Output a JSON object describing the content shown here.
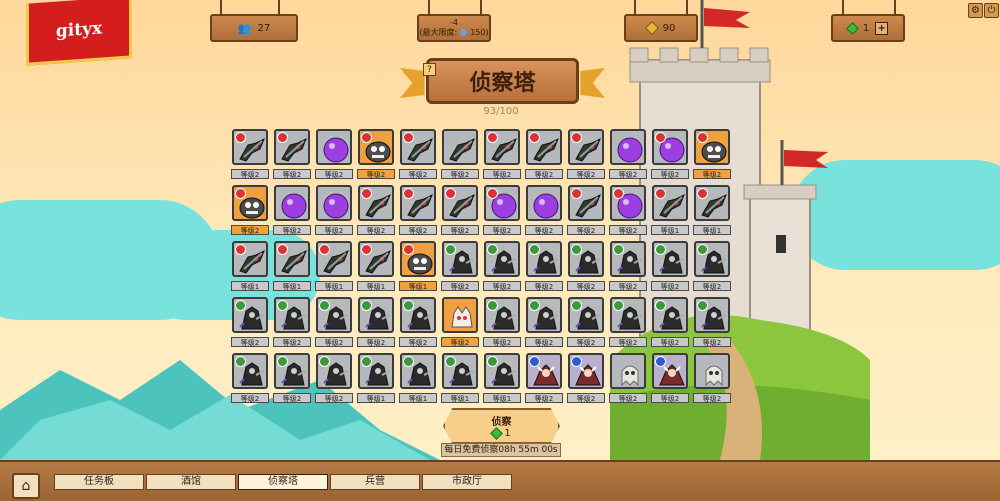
{
  "header": {
    "logo_text": "gityx",
    "population": "27",
    "limit_top": "-4",
    "limit_label": "(最大限度:",
    "limit_value": "150)",
    "gold": "90",
    "gems": "1",
    "plus_label": "+"
  },
  "title": {
    "text": "侦察塔",
    "help": "?",
    "progress": "93/100"
  },
  "cards": [
    {
      "c": "gray",
      "b": "red",
      "f": "sword",
      "l": "等级2",
      "o": false
    },
    {
      "c": "gray",
      "b": "red",
      "f": "sword",
      "l": "等级2",
      "o": false
    },
    {
      "c": "gray",
      "b": "none",
      "f": "blob",
      "l": "等级2",
      "o": false
    },
    {
      "c": "orange",
      "b": "red",
      "f": "ogre",
      "l": "等级2",
      "o": true
    },
    {
      "c": "gray",
      "b": "red",
      "f": "sword",
      "l": "等级2",
      "o": false
    },
    {
      "c": "gray",
      "b": "none",
      "f": "sword",
      "l": "等级2",
      "o": false
    },
    {
      "c": "gray",
      "b": "red",
      "f": "sword",
      "l": "等级2",
      "o": false
    },
    {
      "c": "gray",
      "b": "red",
      "f": "sword",
      "l": "等级2",
      "o": false
    },
    {
      "c": "gray",
      "b": "red",
      "f": "sword",
      "l": "等级2",
      "o": false
    },
    {
      "c": "gray",
      "b": "none",
      "f": "blob",
      "l": "等级2",
      "o": false
    },
    {
      "c": "gray",
      "b": "red",
      "f": "blob",
      "l": "等级2",
      "o": false
    },
    {
      "c": "orange",
      "b": "red",
      "f": "ogre",
      "l": "等级2",
      "o": true
    },
    {
      "c": "orange",
      "b": "red",
      "f": "ogre",
      "l": "等级2",
      "o": true
    },
    {
      "c": "gray",
      "b": "none",
      "f": "blob",
      "l": "等级2",
      "o": false
    },
    {
      "c": "gray",
      "b": "none",
      "f": "blob",
      "l": "等级2",
      "o": false
    },
    {
      "c": "gray",
      "b": "red",
      "f": "sword",
      "l": "等级2",
      "o": false
    },
    {
      "c": "gray",
      "b": "red",
      "f": "sword",
      "l": "等级2",
      "o": false
    },
    {
      "c": "gray",
      "b": "red",
      "f": "sword",
      "l": "等级2",
      "o": false
    },
    {
      "c": "gray",
      "b": "red",
      "f": "blob",
      "l": "等级2",
      "o": false
    },
    {
      "c": "gray",
      "b": "none",
      "f": "blob",
      "l": "等级2",
      "o": false
    },
    {
      "c": "gray",
      "b": "red",
      "f": "sword",
      "l": "等级2",
      "o": false
    },
    {
      "c": "gray",
      "b": "red",
      "f": "blob",
      "l": "等级2",
      "o": false
    },
    {
      "c": "gray",
      "b": "red",
      "f": "sword",
      "l": "等级1",
      "o": false
    },
    {
      "c": "gray",
      "b": "red",
      "f": "sword",
      "l": "等级1",
      "o": false
    },
    {
      "c": "gray",
      "b": "red",
      "f": "sword",
      "l": "等级1",
      "o": false
    },
    {
      "c": "gray",
      "b": "red",
      "f": "sword",
      "l": "等级1",
      "o": false
    },
    {
      "c": "gray",
      "b": "red",
      "f": "sword",
      "l": "等级1",
      "o": false
    },
    {
      "c": "gray",
      "b": "red",
      "f": "sword",
      "l": "等级1",
      "o": false
    },
    {
      "c": "orange",
      "b": "red",
      "f": "ogre",
      "l": "等级1",
      "o": true
    },
    {
      "c": "gray",
      "b": "green",
      "f": "rogue",
      "l": "等级2",
      "o": false
    },
    {
      "c": "gray",
      "b": "green",
      "f": "rogue",
      "l": "等级2",
      "o": false
    },
    {
      "c": "gray",
      "b": "green",
      "f": "rogue",
      "l": "等级2",
      "o": false
    },
    {
      "c": "gray",
      "b": "green",
      "f": "rogue",
      "l": "等级2",
      "o": false
    },
    {
      "c": "gray",
      "b": "green",
      "f": "rogue",
      "l": "等级2",
      "o": false
    },
    {
      "c": "gray",
      "b": "green",
      "f": "rogue",
      "l": "等级2",
      "o": false
    },
    {
      "c": "gray",
      "b": "green",
      "f": "rogue",
      "l": "等级2",
      "o": false
    },
    {
      "c": "gray",
      "b": "green",
      "f": "rogue",
      "l": "等级2",
      "o": false
    },
    {
      "c": "gray",
      "b": "green",
      "f": "rogue",
      "l": "等级2",
      "o": false
    },
    {
      "c": "gray",
      "b": "green",
      "f": "rogue",
      "l": "等级2",
      "o": false
    },
    {
      "c": "gray",
      "b": "green",
      "f": "rogue",
      "l": "等级2",
      "o": false
    },
    {
      "c": "gray",
      "b": "green",
      "f": "rogue",
      "l": "等级2",
      "o": false
    },
    {
      "c": "orange",
      "b": "none",
      "f": "beast",
      "l": "等级2",
      "o": true
    },
    {
      "c": "gray",
      "b": "green",
      "f": "rogue",
      "l": "等级2",
      "o": false
    },
    {
      "c": "gray",
      "b": "green",
      "f": "rogue",
      "l": "等级2",
      "o": false
    },
    {
      "c": "gray",
      "b": "green",
      "f": "rogue",
      "l": "等级2",
      "o": false
    },
    {
      "c": "gray",
      "b": "green",
      "f": "rogue",
      "l": "等级2",
      "o": false
    },
    {
      "c": "gray",
      "b": "green",
      "f": "rogue",
      "l": "等级2",
      "o": false
    },
    {
      "c": "gray",
      "b": "green",
      "f": "rogue",
      "l": "等级2",
      "o": false
    },
    {
      "c": "gray",
      "b": "green",
      "f": "rogue",
      "l": "等级2",
      "o": false
    },
    {
      "c": "gray",
      "b": "green",
      "f": "rogue",
      "l": "等级2",
      "o": false
    },
    {
      "c": "gray",
      "b": "green",
      "f": "rogue",
      "l": "等级2",
      "o": false
    },
    {
      "c": "gray",
      "b": "green",
      "f": "rogue",
      "l": "等级1",
      "o": false
    },
    {
      "c": "gray",
      "b": "green",
      "f": "rogue",
      "l": "等级1",
      "o": false
    },
    {
      "c": "gray",
      "b": "green",
      "f": "rogue",
      "l": "等级1",
      "o": false
    },
    {
      "c": "gray",
      "b": "green",
      "f": "rogue",
      "l": "等级1",
      "o": false
    },
    {
      "c": "purple",
      "b": "blue",
      "f": "mage",
      "l": "等级2",
      "o": false
    },
    {
      "c": "purple",
      "b": "blue",
      "f": "mage",
      "l": "等级2",
      "o": false
    },
    {
      "c": "gray",
      "b": "none",
      "f": "ghost",
      "l": "等级2",
      "o": false
    },
    {
      "c": "purple",
      "b": "blue",
      "f": "mage",
      "l": "等级2",
      "o": false
    },
    {
      "c": "gray",
      "b": "none",
      "f": "ghost",
      "l": "等级2",
      "o": false
    }
  ],
  "scout": {
    "label": "侦察",
    "cost": "1",
    "timer": "每日免费侦察08h 55m 00s"
  },
  "nav": {
    "home_icon": "home-icon",
    "tabs": [
      "任务板",
      "酒馆",
      "侦察塔",
      "兵营",
      "市政厅"
    ],
    "active_tab": "侦察塔"
  },
  "colors": {
    "accent": "#d41e1e",
    "wood": "#b06f38",
    "level_gray": "#c9c9c9",
    "level_orange": "#f3a23b"
  }
}
